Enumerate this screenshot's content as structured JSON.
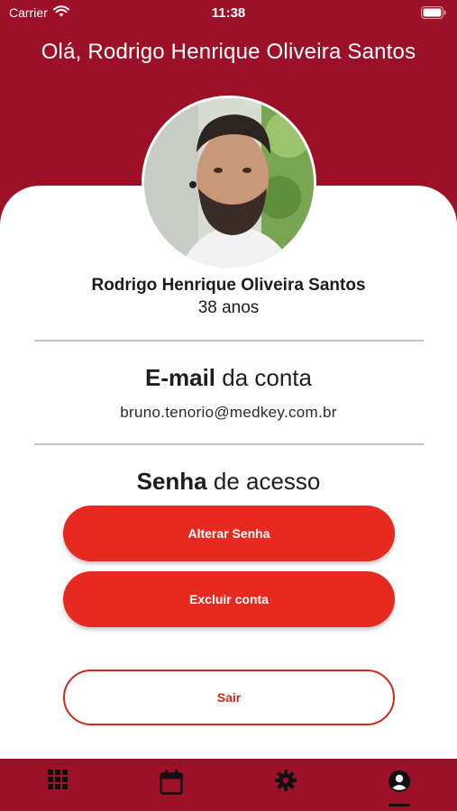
{
  "status_bar": {
    "carrier": "Carrier",
    "time": "11:38",
    "icons": [
      "wifi-icon",
      "battery-icon"
    ]
  },
  "header": {
    "greeting": "Olá, Rodrigo Henrique Oliveira Santos"
  },
  "profile": {
    "name": "Rodrigo Henrique Oliveira Santos",
    "age": "38 anos"
  },
  "email_section": {
    "title_bold": "E-mail",
    "title_rest": " da conta",
    "value": "bruno.tenorio@medkey.com.br"
  },
  "password_section": {
    "title_bold": "Senha",
    "title_rest": " de acesso"
  },
  "buttons": {
    "change_password": "Alterar Senha",
    "delete_account": "Excluir conta",
    "logout": "Sair"
  },
  "bottom_nav": {
    "items": [
      "grid-icon",
      "calendar-icon",
      "gear-icon",
      "user-icon"
    ],
    "active": "user-icon"
  },
  "colors": {
    "brand": "#9c1127",
    "accent": "#e8291f",
    "card": "#ffffff"
  }
}
